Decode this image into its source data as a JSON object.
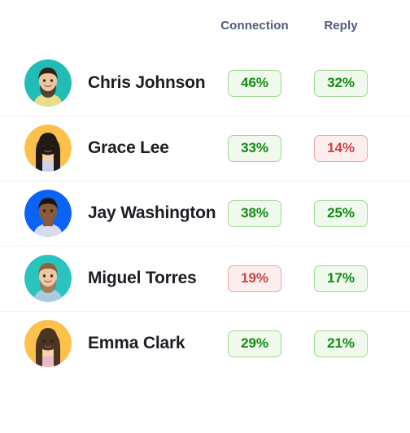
{
  "table": {
    "columns": [
      {
        "label": "Connection",
        "key": "connection"
      },
      {
        "label": "Reply",
        "key": "reply"
      }
    ],
    "rows": [
      {
        "name": "Chris Johnson",
        "avatar_bg": "#21bcb6",
        "avatar_kind": "man-dark-hair-beard",
        "connection": {
          "value": "46%",
          "tone": "good"
        },
        "reply": {
          "value": "32%",
          "tone": "good"
        }
      },
      {
        "name": "Grace Lee",
        "avatar_bg": "#fcc14a",
        "avatar_kind": "woman-black-hair",
        "connection": {
          "value": "33%",
          "tone": "good"
        },
        "reply": {
          "value": "14%",
          "tone": "bad"
        }
      },
      {
        "name": "Jay Washington",
        "avatar_bg": "#0b63f6",
        "avatar_kind": "man-short-hair-smiling",
        "connection": {
          "value": "38%",
          "tone": "good"
        },
        "reply": {
          "value": "25%",
          "tone": "good"
        }
      },
      {
        "name": "Miguel Torres",
        "avatar_bg": "#2bc3bd",
        "avatar_kind": "man-light-brown-hair-beard",
        "connection": {
          "value": "19%",
          "tone": "bad"
        },
        "reply": {
          "value": "17%",
          "tone": "good"
        }
      },
      {
        "name": "Emma Clark",
        "avatar_bg": "#fcc14a",
        "avatar_kind": "woman-long-brown-hair",
        "connection": {
          "value": "29%",
          "tone": "good"
        },
        "reply": {
          "value": "21%",
          "tone": "good"
        }
      }
    ]
  },
  "colors": {
    "good_text": "#118a15",
    "good_bg": "#effaec",
    "good_border": "#9fd894",
    "bad_text": "#c9444a",
    "bad_bg": "#fdeeee",
    "bad_border": "#e9a7a7",
    "header_text": "#4d5c78",
    "name_text": "#1c1e24",
    "divider": "#eff2f9",
    "page_bg": "#ffffff"
  }
}
